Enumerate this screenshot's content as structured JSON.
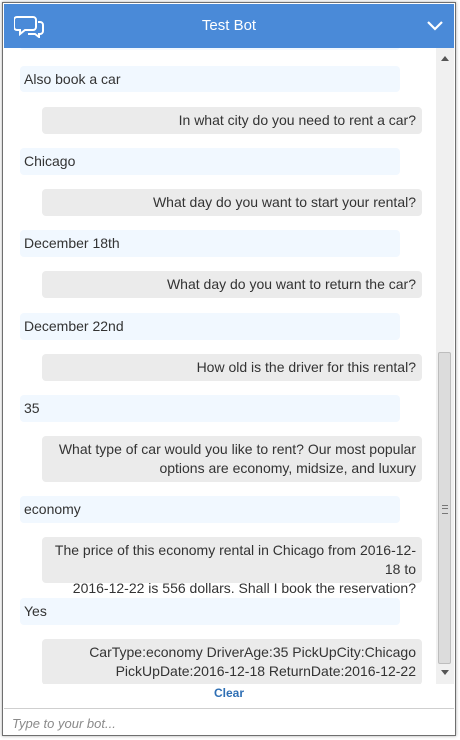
{
  "header": {
    "title": "Test Bot",
    "logo_icon": "chat-bubbles-icon",
    "toggle_icon": "chevron-down-icon",
    "color": "#4a8ad8"
  },
  "messages": [
    {
      "from": "user",
      "text": "Also book a car"
    },
    {
      "from": "bot",
      "text": "In what city do you need to rent a car?"
    },
    {
      "from": "user",
      "text": "Chicago"
    },
    {
      "from": "bot",
      "text": "What day do you want to start your rental?"
    },
    {
      "from": "user",
      "text": "December 18th"
    },
    {
      "from": "bot",
      "text": "What day do you want to return the car?"
    },
    {
      "from": "user",
      "text": "December 22nd"
    },
    {
      "from": "bot",
      "text": "How old is the driver for this rental?"
    },
    {
      "from": "user",
      "text": "35"
    },
    {
      "from": "bot",
      "line1": "What type of car would you like to rent? Our most popular",
      "line2": "options are economy, midsize, and luxury"
    },
    {
      "from": "user",
      "text": "economy"
    },
    {
      "from": "bot",
      "line1": "The price of this economy rental in Chicago from 2016-12-18 to",
      "line2": "2016-12-22 is 556 dollars. Shall I book the reservation?"
    },
    {
      "from": "user",
      "text": "Yes"
    },
    {
      "from": "bot",
      "line1": "CarType:economy DriverAge:35 PickUpCity:Chicago",
      "line2": "PickUpDate:2016-12-18 ReturnDate:2016-12-22"
    }
  ],
  "clear_label": "Clear",
  "input": {
    "placeholder": "Type to your bot..."
  }
}
